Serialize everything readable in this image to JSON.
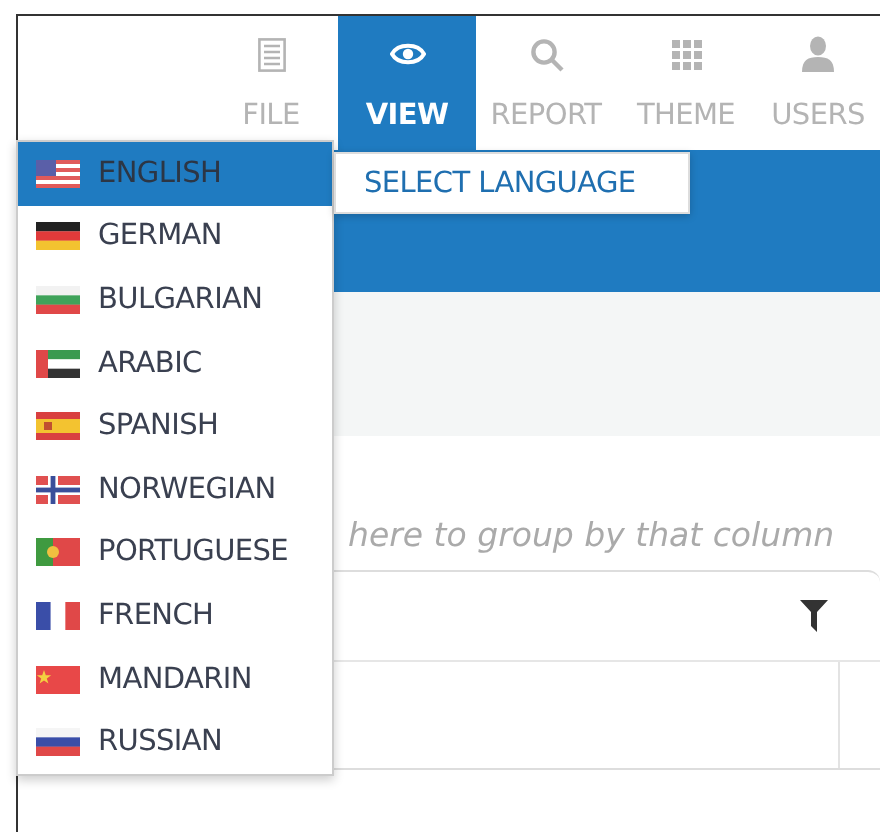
{
  "nav": {
    "tabs": [
      {
        "label": "FILE",
        "kind": "document",
        "selected": false
      },
      {
        "label": "VIEW",
        "kind": "eye",
        "selected": true
      },
      {
        "label": "REPORT",
        "kind": "search",
        "selected": false
      },
      {
        "label": "THEME",
        "kind": "grid",
        "selected": false
      },
      {
        "label": "USERS",
        "kind": "person",
        "selected": false
      }
    ]
  },
  "language_menu": {
    "items": [
      {
        "label": "ENGLISH",
        "kind": "us",
        "selected": true
      },
      {
        "label": "GERMAN",
        "kind": "de",
        "selected": false
      },
      {
        "label": "BULGARIAN",
        "kind": "bg",
        "selected": false
      },
      {
        "label": "ARABIC",
        "kind": "ae",
        "selected": false
      },
      {
        "label": "SPANISH",
        "kind": "es",
        "selected": false
      },
      {
        "label": "NORWEGIAN",
        "kind": "no",
        "selected": false
      },
      {
        "label": "PORTUGUESE",
        "kind": "pt",
        "selected": false
      },
      {
        "label": "FRENCH",
        "kind": "fr",
        "selected": false
      },
      {
        "label": "MANDARIN",
        "kind": "cn",
        "selected": false
      },
      {
        "label": "RUSSIAN",
        "kind": "ru",
        "selected": false
      }
    ]
  },
  "submenu": {
    "label": "SELECT LANGUAGE"
  },
  "grid": {
    "group_hint": "here to group by that column"
  }
}
